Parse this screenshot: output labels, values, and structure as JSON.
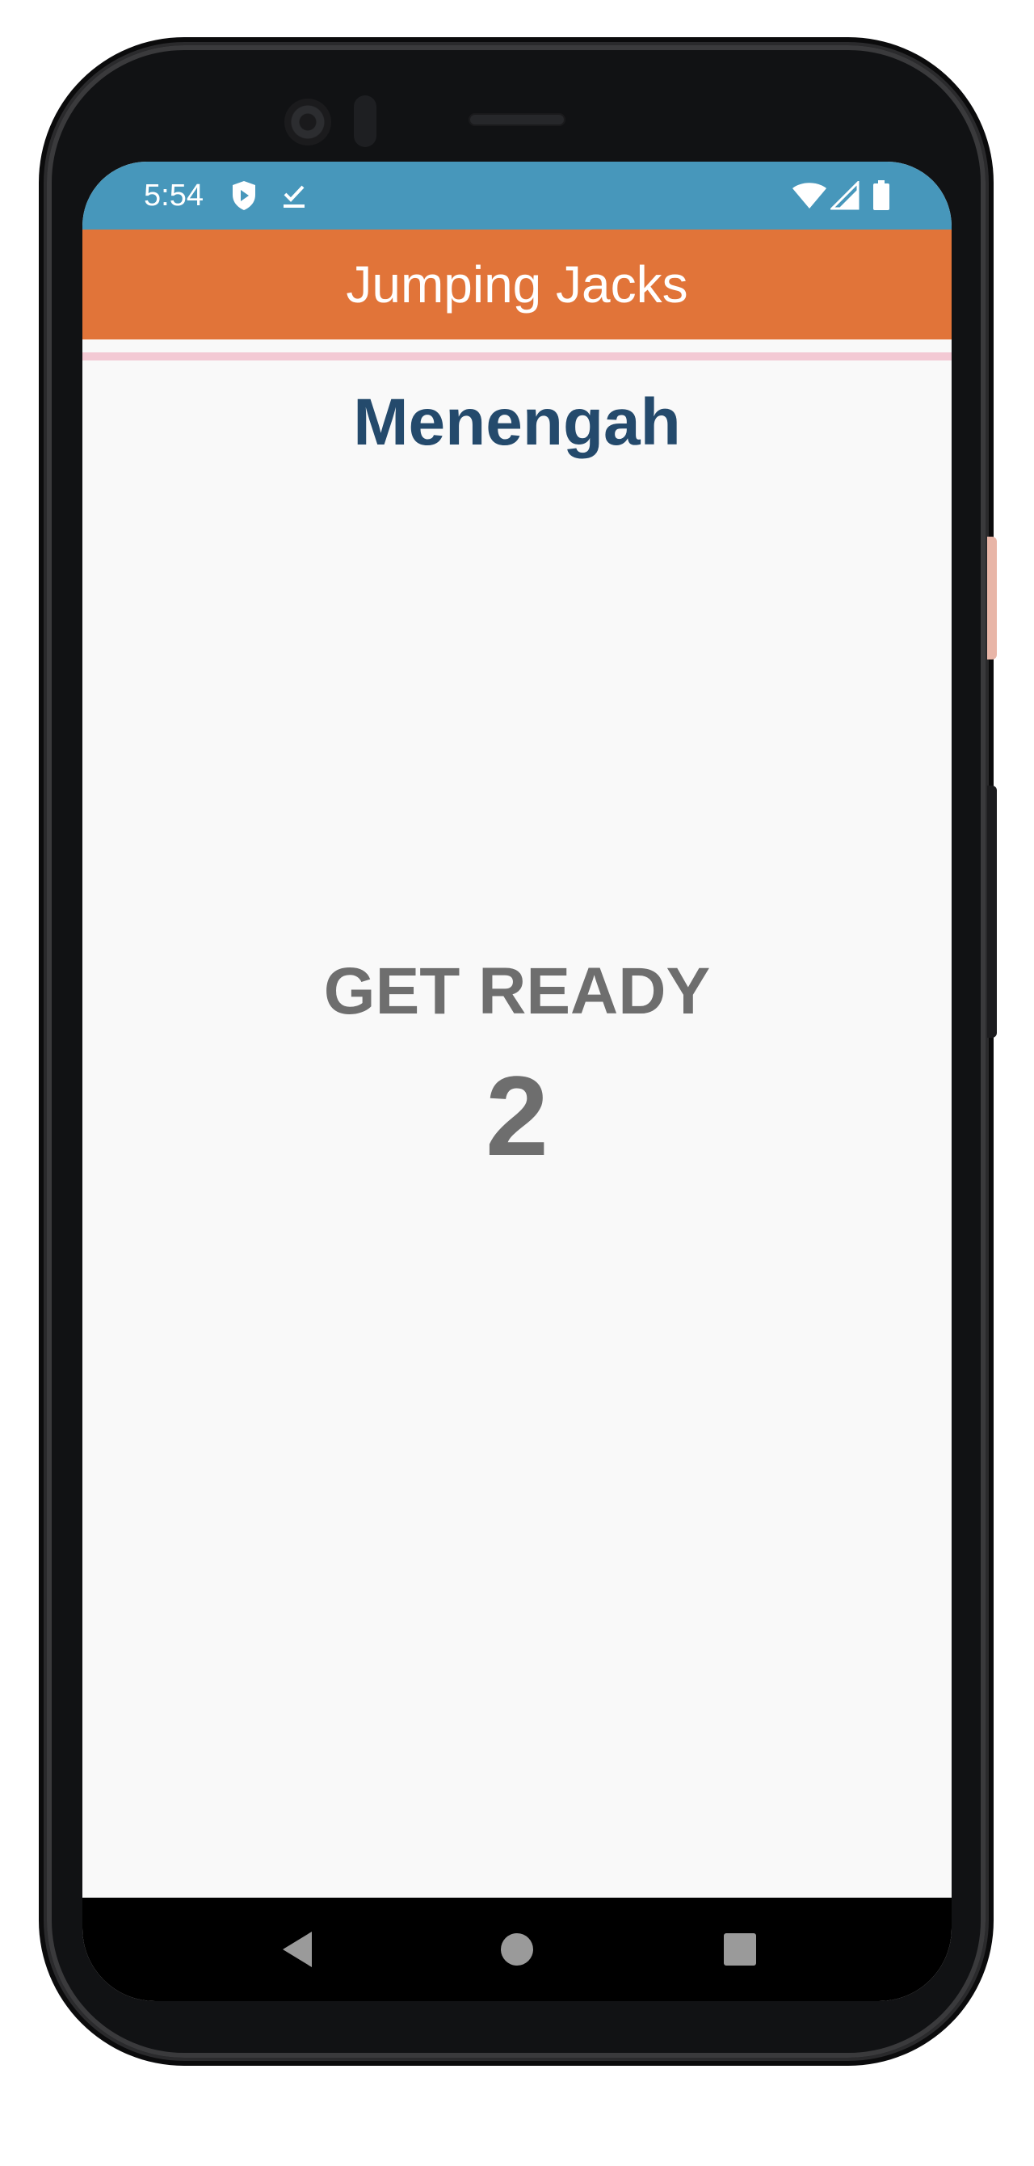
{
  "status_bar": {
    "time": "5:54",
    "left_icons": [
      "play-protect-icon",
      "task-done-icon"
    ],
    "right_icons": [
      "wifi-icon",
      "cellular-signal-icon",
      "battery-icon"
    ],
    "background_color": "#4797bb"
  },
  "app_bar": {
    "title": "Jumping Jacks",
    "background_color": "#e17439"
  },
  "workout": {
    "level": "Menengah",
    "status_text": "GET READY",
    "countdown": "2"
  },
  "nav_bar": {
    "buttons": [
      "back-icon",
      "home-icon",
      "recents-icon"
    ]
  }
}
